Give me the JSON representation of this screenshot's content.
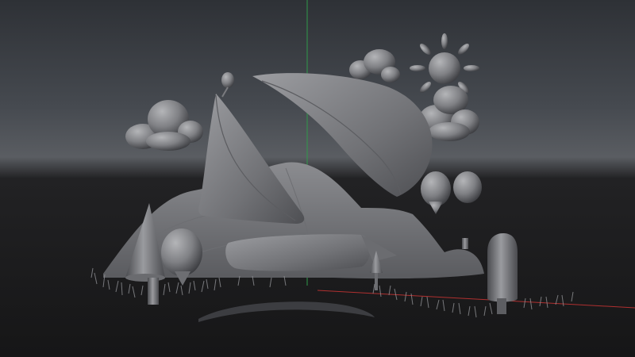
{
  "viewport": {
    "background_top": "#2e3136",
    "background_horizon": "#5a5d62",
    "background_bottom": "#161617",
    "model_color": "#7f8084",
    "y_axis_color": "#2f9a4a",
    "x_axis_color": "#b03030"
  },
  "scene": {
    "objects": [
      "sun-icon",
      "cloud-left",
      "cloud-right",
      "balloon-sail",
      "triangle-sail",
      "hill",
      "log-raft",
      "cone-tree",
      "balloon-tree",
      "pill-tree",
      "grass",
      "curved-stick"
    ]
  }
}
